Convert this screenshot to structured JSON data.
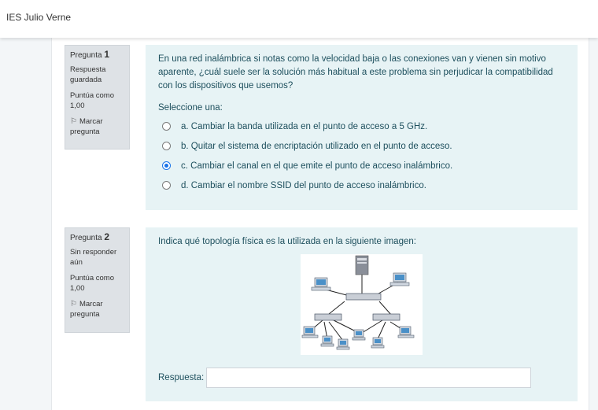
{
  "header": {
    "site_name": "IES Julio Verne"
  },
  "questions": [
    {
      "label": "Pregunta",
      "number": "1",
      "state": "Respuesta guardada",
      "grade": "Puntúa como 1,00",
      "flag_label": "Marcar pregunta",
      "text": "En una red inalámbrica si notas como la velocidad baja o las conexiones van y vienen sin motivo aparente, ¿cuál suele ser la solución más habitual a este problema sin perjudicar la compatibilidad con los dispositivos que usemos?",
      "prompt": "Seleccione una:",
      "options": [
        {
          "label": "a. Cambiar la banda utilizada en el punto de acceso a 5 GHz.",
          "selected": false
        },
        {
          "label": "b. Quitar el sistema de encriptación utilizado en el punto de acceso.",
          "selected": false
        },
        {
          "label": "c. Cambiar el canal en el que emite el punto de acceso inalámbrico.",
          "selected": true
        },
        {
          "label": "d. Cambiar el nombre SSID del punto de acceso inalámbrico.",
          "selected": false
        }
      ]
    },
    {
      "label": "Pregunta",
      "number": "2",
      "state": "Sin responder aún",
      "grade": "Puntúa como 1,00",
      "flag_label": "Marcar pregunta",
      "text": "Indica qué topología física es la utilizada en la siguiente imagen:",
      "answer_label": "Respuesta:",
      "answer_value": ""
    }
  ],
  "colors": {
    "accent": "#1a73e8",
    "content_bg": "#e7f3f5",
    "info_bg": "#dee2e6"
  }
}
